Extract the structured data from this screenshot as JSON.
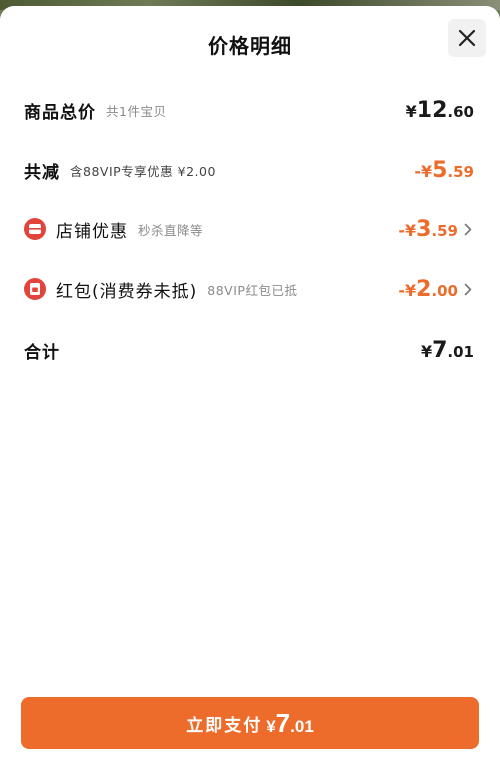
{
  "sheet": {
    "title": "价格明细",
    "close_icon": "close-icon"
  },
  "rows": {
    "total": {
      "label": "商品总价",
      "sub": "共1件宝贝",
      "prefix": "¥",
      "int": "12",
      "dec": ".60"
    },
    "reduction": {
      "label": "共减",
      "sub": "含88VIP专享优惠 ¥2.00",
      "prefix": "-¥",
      "int": "5",
      "dec": ".59"
    },
    "store": {
      "icon": "store-coupon-icon",
      "label": "店铺优惠",
      "sub": "秒杀直降等",
      "prefix": "-¥",
      "int": "3",
      "dec": ".59"
    },
    "redpacket": {
      "icon": "red-packet-icon",
      "label": "红包(消费券未抵)",
      "sub": "88VIP红包已抵",
      "prefix": "-¥",
      "int": "2",
      "dec": ".00"
    },
    "sum": {
      "label": "合计",
      "prefix": "¥",
      "int": "7",
      "dec": ".01"
    }
  },
  "pay": {
    "label": "立即支付",
    "prefix": "¥",
    "int": "7",
    "dec": ".01"
  },
  "colors": {
    "accent": "#ee6c2b",
    "icon_red": "#e2433b",
    "text": "#111111",
    "muted": "#8a8a8a"
  }
}
